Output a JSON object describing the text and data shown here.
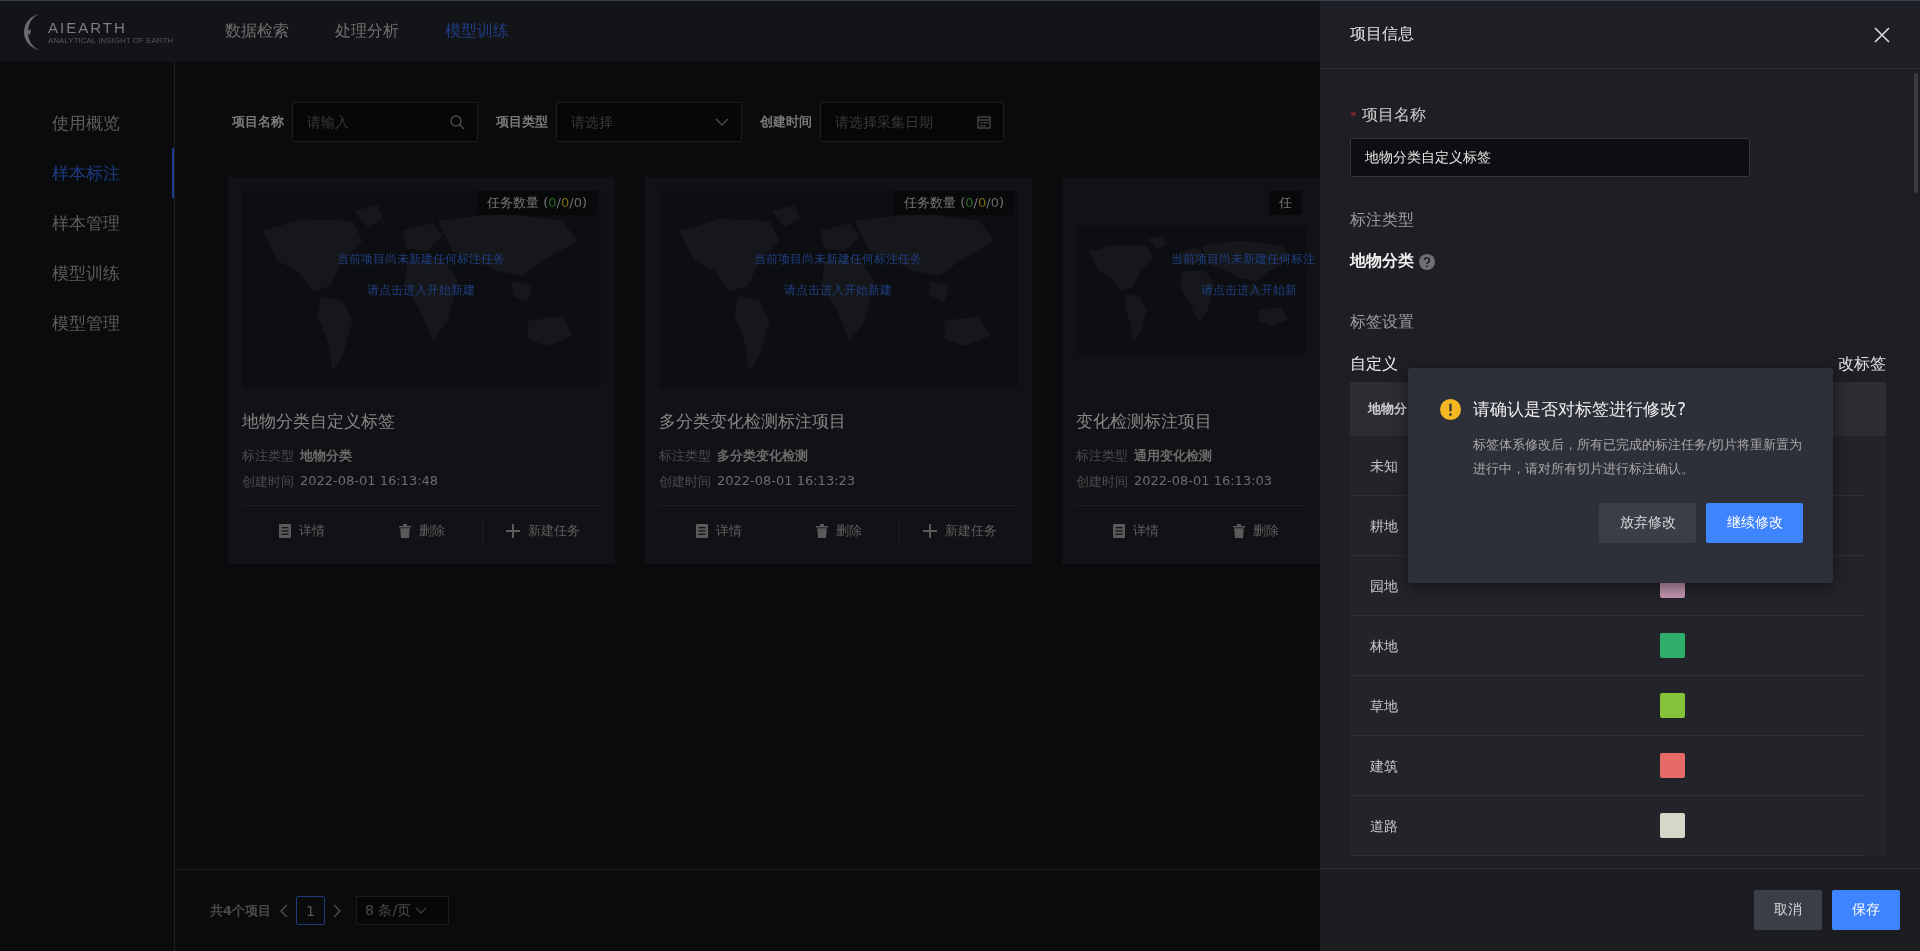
{
  "header": {
    "logo": {
      "name": "AIEARTH",
      "tagline": "ANALYTICAL INSIGHT OF EARTH"
    },
    "nav": [
      {
        "label": "数据检索",
        "selected": false
      },
      {
        "label": "处理分析",
        "selected": false
      },
      {
        "label": "模型训练",
        "selected": true
      }
    ]
  },
  "sidebar": {
    "items": [
      {
        "label": "使用概览",
        "selected": false
      },
      {
        "label": "样本标注",
        "selected": true
      },
      {
        "label": "样本管理",
        "selected": false
      },
      {
        "label": "模型训练",
        "selected": false
      },
      {
        "label": "模型管理",
        "selected": false
      }
    ]
  },
  "filters": [
    {
      "label": "项目名称",
      "placeholder": "请输入",
      "kind": "search"
    },
    {
      "label": "项目类型",
      "placeholder": "请选择",
      "kind": "select"
    },
    {
      "label": "创建时间",
      "placeholder": "请选择采集日期",
      "kind": "date"
    }
  ],
  "cards": [
    {
      "task_count": {
        "label": "任务数量 (",
        "counts": [
          {
            "value": "0",
            "color": "#2f6a25"
          },
          {
            "value": "0",
            "color": "#7d6c12"
          },
          {
            "value": "0",
            "color": "#6a6a6a"
          }
        ],
        "separator": "/",
        "close": ")"
      },
      "empty_message": [
        "当前项目尚未新建任何标注任务",
        "请点击进入开始新建"
      ],
      "title": "地物分类自定义标签",
      "meta": [
        {
          "label": "标注类型",
          "value": "地物分类"
        },
        {
          "label": "创建时间",
          "value": "2022-08-01 16:13:48"
        }
      ],
      "actions": [
        {
          "label": "详情",
          "kind": "detail"
        },
        {
          "label": "删除",
          "kind": "delete"
        },
        {
          "label": "新建任务",
          "kind": "add"
        }
      ]
    },
    {
      "task_count": {
        "label": "任务数量 (",
        "counts": [
          {
            "value": "0",
            "color": "#2f6a25"
          },
          {
            "value": "0",
            "color": "#7d6c12"
          },
          {
            "value": "0",
            "color": "#6a6a6a"
          }
        ],
        "separator": "/",
        "close": ")"
      },
      "empty_message": [
        "当前项目尚未新建任何标注任务",
        "请点击进入开始新建"
      ],
      "title": "多分类变化检测标注项目",
      "meta": [
        {
          "label": "标注类型",
          "value": "多分类变化检测"
        },
        {
          "label": "创建时间",
          "value": "2022-08-01 16:13:23"
        }
      ],
      "actions": [
        {
          "label": "详情",
          "kind": "detail"
        },
        {
          "label": "删除",
          "kind": "delete"
        },
        {
          "label": "新建任务",
          "kind": "add"
        }
      ]
    },
    {
      "task_count": {
        "label": "任"
      },
      "empty_message": [
        "当前项目尚未新建任何标注",
        "请点击进入开始新"
      ],
      "title": "变化检测标注项目",
      "meta": [
        {
          "label": "标注类型",
          "value": "通用变化检测"
        },
        {
          "label": "创建时间",
          "value": "2022-08-01 16:13:03"
        }
      ],
      "actions": [
        {
          "label": "详情",
          "kind": "detail"
        },
        {
          "label": "删除",
          "kind": "delete"
        }
      ]
    }
  ],
  "pagination": {
    "total": "共4个项目",
    "pages": [
      {
        "label": "1",
        "selected": true
      }
    ],
    "page_size": "8 条/页"
  },
  "drawer": {
    "title": "项目信息",
    "name_field": {
      "required_mark": "*",
      "label": "项目名称",
      "value": "地物分类自定义标签"
    },
    "type_section": {
      "heading": "标注类型",
      "value": "地物分类"
    },
    "label_section": {
      "heading": "标签设置",
      "subheading": "自定义",
      "edit_link": "改标签",
      "table": {
        "header": "地物分",
        "rows": [
          {
            "name": "未知"
          },
          {
            "name": "耕地"
          },
          {
            "name": "园地",
            "color": "#c496b0"
          },
          {
            "name": "林地",
            "color": "#2eae6a"
          },
          {
            "name": "草地",
            "color": "#84c23a"
          },
          {
            "name": "建筑",
            "color": "#e66a68"
          },
          {
            "name": "道路",
            "color": "#d3d8c8"
          }
        ]
      }
    },
    "buttons": [
      {
        "label": "取消",
        "kind": "secondary"
      },
      {
        "label": "保存",
        "kind": "primary"
      }
    ]
  },
  "dialog": {
    "title": "请确认是否对标签进行修改?",
    "message": "标签体系修改后，所有已完成的标注任务/切片将重新置为进行中，请对所有切片进行标注确认。",
    "buttons": [
      {
        "label": "放弃修改",
        "kind": "secondary"
      },
      {
        "label": "继续修改",
        "kind": "primary"
      }
    ]
  }
}
